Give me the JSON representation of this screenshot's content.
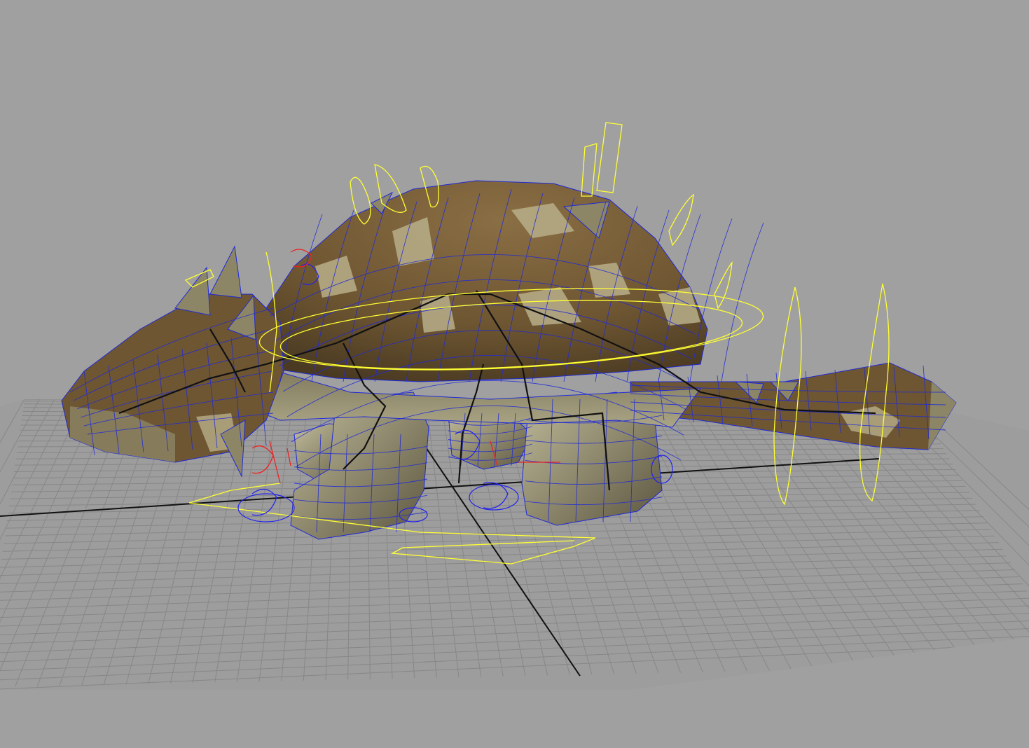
{
  "viewport": {
    "type": "3d-perspective-viewport",
    "shading": "smooth-shaded-with-wireframe",
    "background_color": "#a0a0a0"
  },
  "scene": {
    "model": "ankylosaurus-character-rig",
    "colors": {
      "ground_grid": "#8a8a8a",
      "grid_axis": "#111111",
      "body_shell": "#6e5632",
      "belly": "#8c8666",
      "spots": "#b8af8a",
      "wireframe": "#1f2ad8",
      "joints": "#111111",
      "controls_main": "#ffff33",
      "controls_ik": "#2222ee",
      "controls_selected": "#ee2222"
    }
  }
}
